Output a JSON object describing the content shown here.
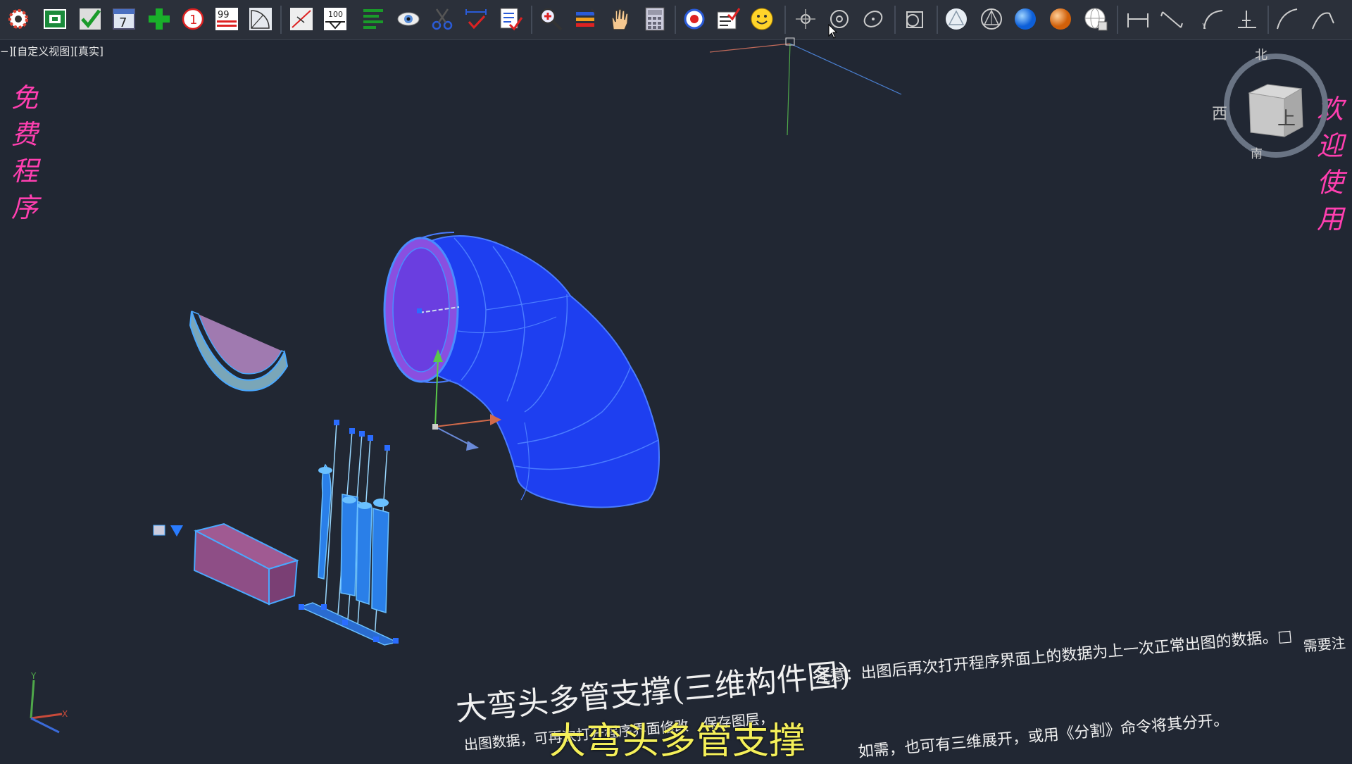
{
  "toolbar": {
    "buttons": [
      "settings-gear-icon",
      "frame-icon",
      "check-icon",
      "calendar-7-icon",
      "add-plus-icon",
      "number-1-icon",
      "number-99-icon",
      "fan-sector-icon",
      "line-break-icon",
      "dimension-100-icon",
      "list-lines-icon",
      "eye-icon",
      "scissors-icon",
      "measure-check-icon",
      "edit-list-icon",
      "zoom-icon",
      "layers-icon",
      "pan-hand-icon",
      "calculator-icon",
      "orbit-icon",
      "checklist-icon",
      "smiley-icon",
      "move-3d-icon",
      "rotate-3d-icon",
      "orbit-free-icon",
      "box-icon",
      "shade-wire-icon",
      "shade-hidden-icon",
      "shade-realistic-icon",
      "shade-conceptual-icon",
      "globe-icon",
      "dim-linear-icon",
      "dim-aligned-icon",
      "dim-arc-icon",
      "dim-ordinate-icon",
      "dim-radius-icon",
      "dim-angle-icon"
    ]
  },
  "viewport": {
    "label": "−][自定义视图][真实]"
  },
  "left_vertical": [
    "免",
    "费",
    "程",
    "序"
  ],
  "right_vertical": [
    "欢",
    "迎",
    "使",
    "用"
  ],
  "viewcube": {
    "north": "北",
    "west": "西",
    "south": "南",
    "top": "上"
  },
  "notes": {
    "title": "大弯头多管支撑(三维构件图)",
    "line1": "注意：出图后再次打开程序界面上的数据为上一次正常出图的数据。□",
    "line1_tail": "需要注",
    "line2_left": "出图数据，可再次打开程序界面修改",
    "line2_mid": "保存图层，",
    "line3": "如需，也可有三维展开，或用《分割》命令将其分开。"
  },
  "subtitle": "大弯头多管支撑",
  "colors": {
    "background": "#212733",
    "elbow": "#1a3df0",
    "accent_magenta": "#ff3fb0",
    "subtitle_yellow": "#f5f05a"
  }
}
